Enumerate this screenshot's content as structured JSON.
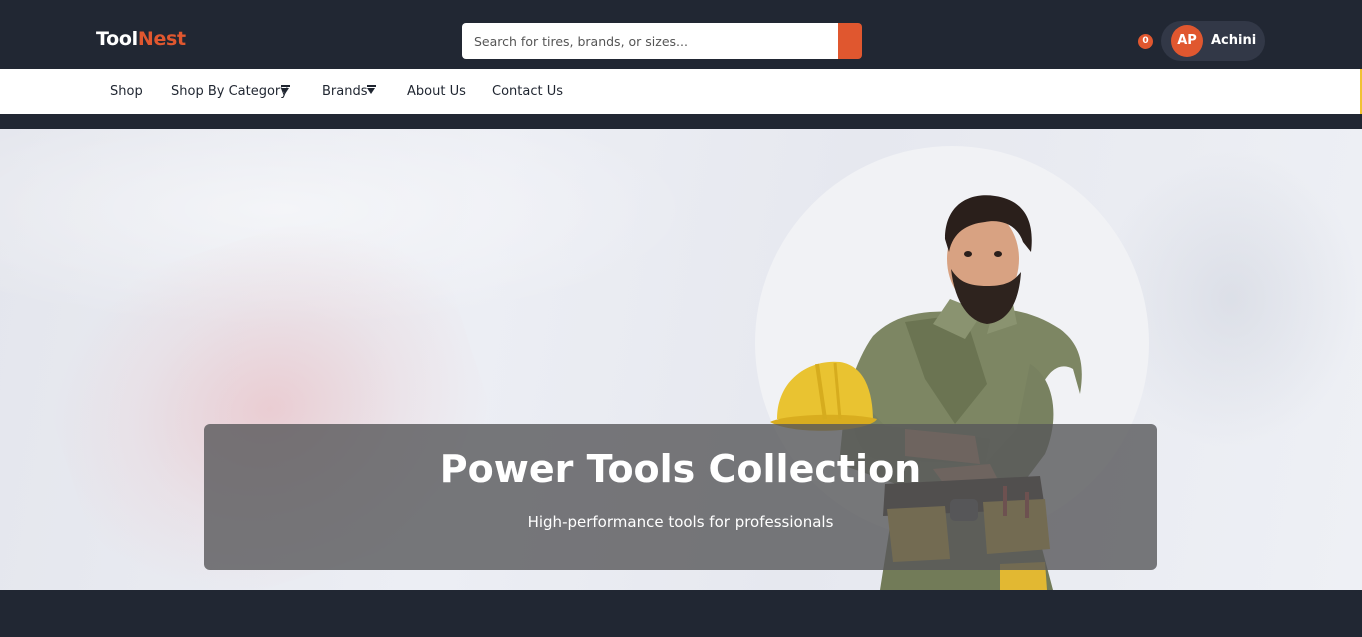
{
  "brand": {
    "part1": "Tool",
    "part2": "Nest"
  },
  "search": {
    "placeholder": "Search for tires, brands, or sizes...",
    "value": "",
    "button_icon": "search-icon"
  },
  "cart": {
    "count": "0",
    "icon": "cart-icon"
  },
  "user": {
    "initials": "AP",
    "name": "Achini"
  },
  "nav": {
    "shop": "Shop",
    "shop_by_category": "Shop By Category",
    "brands": "Brands",
    "about": "About Us",
    "contact": "Contact Us"
  },
  "hero": {
    "title": "Power Tools Collection",
    "subtitle": "High-performance tools for professionals"
  },
  "colors": {
    "header_bg": "#212733",
    "accent": "#e0572f",
    "nav_bg": "#ffffff",
    "overlay": "rgba(88,88,90,0.80)"
  }
}
